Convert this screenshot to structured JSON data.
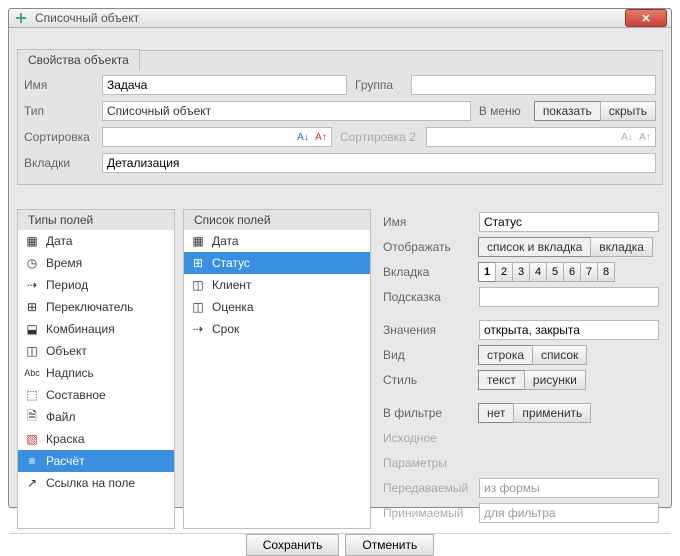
{
  "window": {
    "title": "Списочный объект"
  },
  "props_group": {
    "title": "Свойства объекта",
    "name_label": "Имя",
    "name_value": "Задача",
    "group_label": "Группа",
    "group_value": "",
    "type_label": "Тип",
    "type_value": "Списочный объект",
    "menu_label": "В меню",
    "menu_show": "показать",
    "menu_hide": "скрыть",
    "sort_label": "Сортировка",
    "sort2_label": "Сортировка 2",
    "tabs_label": "Вкладки",
    "tabs_value": "Детализация"
  },
  "field_types": {
    "title": "Типы полей",
    "items": [
      {
        "icon": "grid",
        "label": "Дата"
      },
      {
        "icon": "clock",
        "label": "Время"
      },
      {
        "icon": "period",
        "label": "Период"
      },
      {
        "icon": "switch",
        "label": "Переключатель"
      },
      {
        "icon": "combo",
        "label": "Комбинация"
      },
      {
        "icon": "object",
        "label": "Объект"
      },
      {
        "icon": "text",
        "label": "Надпись"
      },
      {
        "icon": "compound",
        "label": "Составное"
      },
      {
        "icon": "file",
        "label": "Файл"
      },
      {
        "icon": "color",
        "label": "Краска"
      },
      {
        "icon": "calc",
        "label": "Расчёт"
      },
      {
        "icon": "link",
        "label": "Ссылка на поле"
      }
    ],
    "selected_index": 10
  },
  "field_list": {
    "title": "Список полей",
    "items": [
      {
        "icon": "grid",
        "label": "Дата"
      },
      {
        "icon": "switch",
        "label": "Статус"
      },
      {
        "icon": "object",
        "label": "Клиент"
      },
      {
        "icon": "object",
        "label": "Оценка"
      },
      {
        "icon": "period",
        "label": "Срок"
      }
    ],
    "selected_index": 1
  },
  "field_props": {
    "name_label": "Имя",
    "name_value": "Статус",
    "display_label": "Отображать",
    "display_opt1": "список и вкладка",
    "display_opt2": "вкладка",
    "tab_label": "Вкладка",
    "tab_numbers": [
      "1",
      "2",
      "3",
      "4",
      "5",
      "6",
      "7",
      "8"
    ],
    "tab_selected": 0,
    "hint_label": "Подсказка",
    "hint_value": "",
    "values_label": "Значения",
    "values_value": "открыта, закрыта",
    "view_label": "Вид",
    "view_opt1": "строка",
    "view_opt2": "список",
    "style_label": "Стиль",
    "style_opt1": "текст",
    "style_opt2": "рисунки",
    "filter_label": "В фильтре",
    "filter_opt1": "нет",
    "filter_opt2": "применить",
    "initial_label": "Исходное",
    "params_label": "Параметры",
    "passed_label": "Передаваемый",
    "passed_value": "из формы",
    "received_label": "Принимаемый",
    "received_value": "для фильтра"
  },
  "dialog": {
    "save": "Сохранить",
    "cancel": "Отменить"
  },
  "icons": {
    "grid": "▦",
    "clock": "◷",
    "period": "⇢",
    "switch": "⊞",
    "combo": "⬓",
    "object": "◫",
    "text": "Abc",
    "compound": "⬚",
    "file": "🗎",
    "color": "▧",
    "calc": "≡",
    "link": "↗"
  }
}
